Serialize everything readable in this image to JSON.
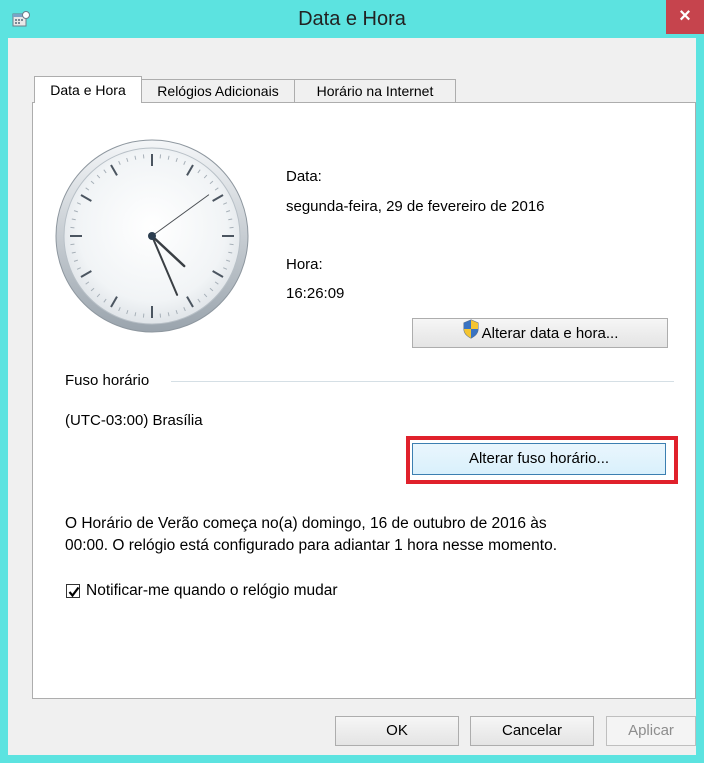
{
  "window": {
    "title": "Data e Hora",
    "close_label": "×"
  },
  "tabs": [
    {
      "label": "Data e Hora",
      "active": true
    },
    {
      "label": "Relógios Adicionais",
      "active": false
    },
    {
      "label": "Horário na Internet",
      "active": false
    }
  ],
  "clock": {
    "hours": 16,
    "minutes": 26,
    "seconds": 9
  },
  "date": {
    "label": "Data:",
    "value": "segunda-feira, 29 de fevereiro de 2016"
  },
  "time": {
    "label": "Hora:",
    "value": "16:26:09"
  },
  "change_datetime_button": "Alterar data e hora...",
  "timezone": {
    "group_label": "Fuso horário",
    "value": "(UTC-03:00) Brasília",
    "change_button": "Alterar fuso horário..."
  },
  "dst_info": {
    "line1": "O Horário de Verão começa no(a) domingo, 16 de outubro de 2016 às",
    "line2": "00:00. O relógio está configurado para adiantar 1 hora nesse momento."
  },
  "notify_checkbox": {
    "label": "Notificar-me quando o relógio mudar",
    "checked": true
  },
  "footer": {
    "ok": "OK",
    "cancel": "Cancelar",
    "apply": "Aplicar"
  },
  "colors": {
    "titlebar": "#5ce3e0",
    "close": "#c6444d",
    "highlight": "#e0212b"
  }
}
